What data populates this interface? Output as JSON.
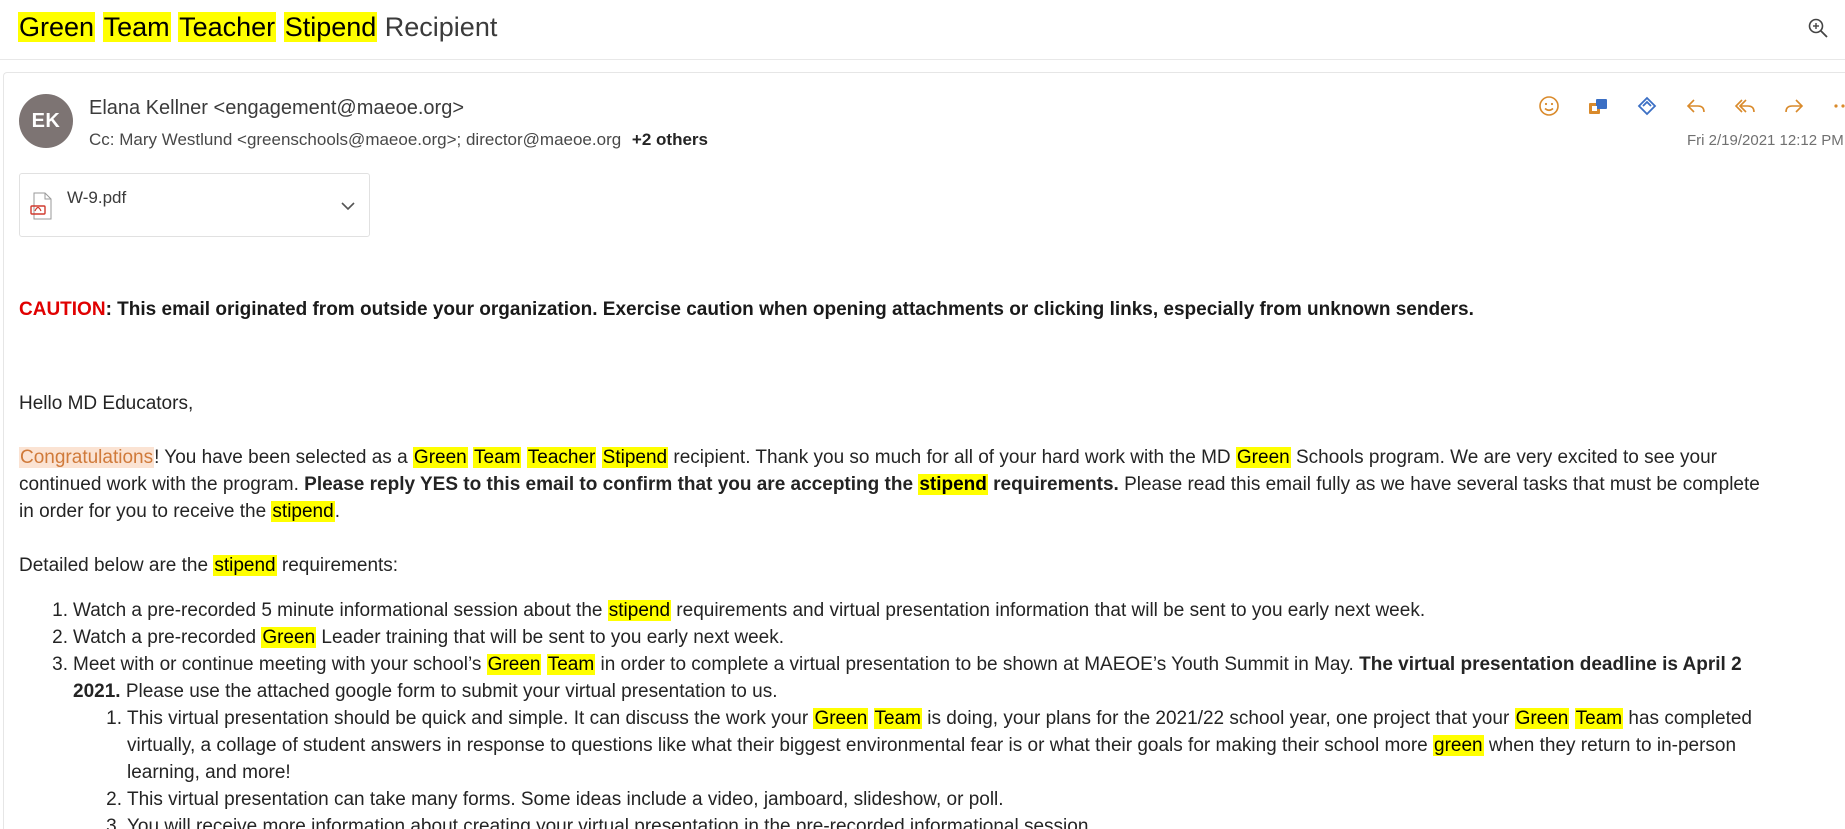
{
  "subject": {
    "words": [
      "Green",
      "Team",
      "Teacher",
      "Stipend"
    ],
    "rest": "Recipient"
  },
  "header": {
    "avatar_initials": "EK",
    "sender": "Elana Kellner <engagement@maeoe.org>",
    "cc_label": "Cc:",
    "cc_recipients": "Mary Westlund <greenschools@maeoe.org>;  director@maeoe.org",
    "cc_others": "+2 others",
    "date": "Fri 2/19/2021 12:12 PM"
  },
  "actions": [
    "smiley-icon",
    "teams-icon",
    "loop-icon",
    "reply-icon",
    "reply-all-icon",
    "forward-icon",
    "more-icon"
  ],
  "attachment": {
    "name": "W-9.pdf"
  },
  "caution": {
    "label": "CAUTION",
    "text": ": This email originated from outside your organization. Exercise caution when opening attachments or clicking links, especially from unknown senders."
  },
  "greeting": "Hello MD Educators,",
  "para1": {
    "congrats": "Congratulations",
    "a": "! You have been selected as a ",
    "h1": "Green",
    "h2": "Team",
    "h3": "Teacher",
    "h4": "Stipend",
    "b": " recipient. Thank you so much for all of your hard work with the MD ",
    "h5": "Green",
    "c": " Schools program. We are very excited to see your",
    "line2a": "continued work with the program. ",
    "bold1": "Please reply YES to this email to confirm that you are accepting the ",
    "bold_hl": "stipend",
    "bold2": " requirements.",
    "line2b": " Please read this email fully as we have several tasks that must be complete",
    "line3a": "in order for you to receive the ",
    "line3hl": "stipend",
    "line3b": "."
  },
  "detailed": {
    "a": "Detailed below are the ",
    "hl": "stipend",
    "b": " requirements:"
  },
  "list": {
    "n1": "1.",
    "i1a": "Watch a pre-recorded 5 minute informational session about the ",
    "i1hl": "stipend",
    "i1b": " requirements and virtual presentation information that will be sent to you early next week.",
    "n2": "2.",
    "i2a": "Watch a pre-recorded ",
    "i2hl": "Green",
    "i2b": " Leader training that will be sent to you early next week.",
    "n3": "3.",
    "i3a": "Meet with or continue meeting with your school’s ",
    "i3hl1": "Green",
    "i3hl2": "Team",
    "i3b": " in order to complete a virtual presentation to be shown at MAEOE’s Youth Summit in May. ",
    "i3bold": "The virtual presentation deadline is April 2",
    "i3l2bold": "2021.",
    "i3l2": " Please use the attached google form to submit your virtual presentation to us.",
    "s1n": "1.",
    "s1a": "This virtual presentation should be quick and simple. It can discuss the work your ",
    "s1hl1": "Green",
    "s1hl2": "Team",
    "s1b": " is doing, your plans for the 2021/22 school year, one project that your ",
    "s1hl3": "Green",
    "s1hl4": "Team",
    "s1c": " has completed",
    "s1l2a": "virtually, a collage of student answers in response to questions like what their biggest environmental fear is or what their goals for making their school more ",
    "s1l2hl": "green",
    "s1l2b": " when they return to in-person",
    "s1l3": "learning, and more!",
    "s2n": "2.",
    "s2": "This virtual presentation can take many forms. Some ideas include a video, jamboard, slideshow, or poll.",
    "s3n": "3.",
    "s3": "You will receive more information about creating your virtual presentation in the pre-recorded informational session."
  }
}
